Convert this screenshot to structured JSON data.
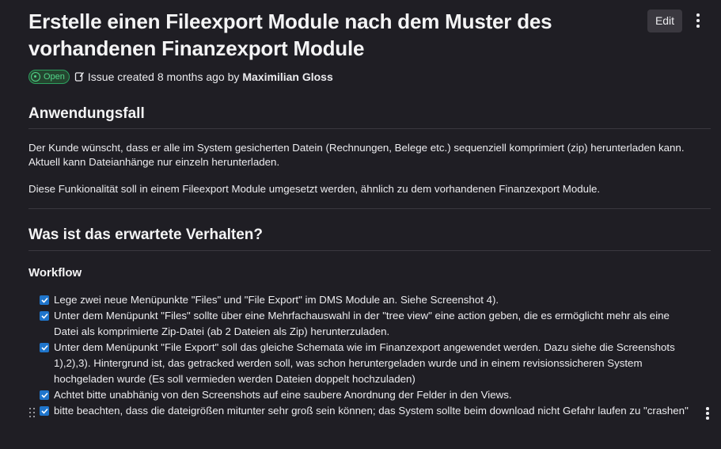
{
  "issue": {
    "title": "Erstelle einen Fileexport Module nach dem Muster des vorhandenen Finanzexport Module",
    "edit_label": "Edit",
    "status": "Open",
    "meta_text": "Issue created 8 months ago by",
    "author": "Maximilian Gloss"
  },
  "sections": {
    "usecase_heading": "Anwendungsfall",
    "usecase_p1_line1": "Der Kunde wünscht, dass er alle im System gesicherten Datein (Rechnungen, Belege etc.) sequenziell komprimiert (zip) herunterladen kann.",
    "usecase_p1_line2": "Aktuell kann Dateianhänge nur einzeln herunterladen.",
    "usecase_p2": "Diese Funkionalität soll in einem Fileexport Module umgesetzt werden, ähnlich zu dem vorhandenen Finanzexport Module.",
    "expected_heading": "Was ist das erwartete Verhalten?",
    "workflow_heading": "Workflow"
  },
  "tasks": [
    {
      "text": "Lege zwei neue Menüpunkte \"Files\" und \"File Export\" im DMS Module an. Siehe Screenshot 4).",
      "checked": true
    },
    {
      "text": "Unter dem Menüpunkt \"Files\" sollte über eine Mehrfachauswahl in der \"tree view\" eine action geben, die es ermöglicht mehr als eine Datei als komprimierte Zip-Datei (ab 2 Dateien als Zip) herunterzuladen.",
      "checked": true
    },
    {
      "text": "Unter dem Menüpunkt \"File Export\" soll das gleiche Schemata wie im Finanzexport angewendet werden. Dazu siehe die Screenshots 1),2),3). Hintergrund ist, das getracked werden soll, was schon heruntergeladen wurde und in einem revisionssicheren System hochgeladen wurde (Es soll vermieden werden Dateien doppelt hochzuladen)",
      "checked": true
    },
    {
      "text": "Achtet bitte unabhänig von den Screenshots auf eine saubere Anordnung der Felder in den Views.",
      "checked": true
    },
    {
      "text": "bitte beachten, dass die dateigrößen mitunter sehr groß sein können; das System sollte beim download nicht Gefahr laufen zu \"crashen\"",
      "checked": true
    }
  ],
  "icons": {
    "edit": "kebab-menu-icon",
    "status": "issue-open-icon",
    "drag": "drag-handle-icon"
  },
  "colors": {
    "background": "#1f1e24",
    "status_green": "#52d58a",
    "checkbox_blue": "#1f75cb"
  }
}
